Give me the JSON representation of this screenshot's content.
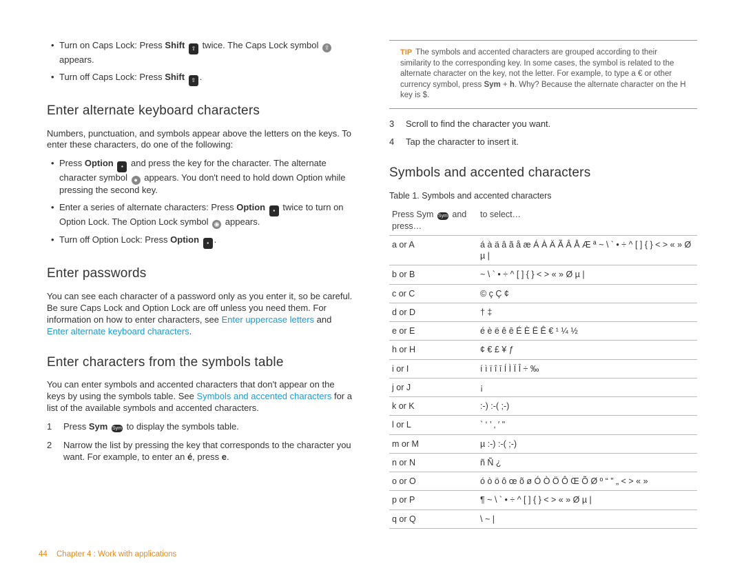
{
  "left": {
    "caps_on_a": "Turn on Caps Lock: Press ",
    "caps_on_b": " twice. The Caps Lock symbol ",
    "caps_on_c": " appears.",
    "caps_off_a": "Turn off Caps Lock: Press ",
    "h1": "Enter alternate keyboard characters",
    "p1": "Numbers, punctuation, and symbols appear above the letters on the keys. To enter these characters, do one of the following:",
    "alt1a": "Press ",
    "alt1b": " and press the key for the character. The alternate character symbol ",
    "alt1c": " appears. You don't need to hold down Option while pressing the second key.",
    "alt2a": "Enter a series of alternate characters: Press ",
    "alt2b": " twice to turn on Option Lock. The Option Lock symbol ",
    "alt2c": " appears.",
    "alt3a": "Turn off Option Lock: Press ",
    "h2": "Enter passwords",
    "p2a": "You can see each character of a password only as you enter it, so be careful. Be sure Caps Lock and Option Lock are off unless you need them. For information on how to enter characters, see ",
    "p2link1": "Enter uppercase letters",
    "p2mid": " and ",
    "p2link2": "Enter alternate keyboard characters",
    "h3": "Enter characters from the symbols table",
    "p3a": "You can enter symbols and accented characters that don't appear on the keys by using the symbols table. See ",
    "p3link": "Symbols and accented characters",
    "p3b": " for a list of the available symbols and accented characters.",
    "step1a": "Press ",
    "step1b": " to display the symbols table.",
    "step2a": "Narrow the list by pressing the key that corresponds to the character you want. For example, to enter an ",
    "step2b": ", press ",
    "word_shift": "Shift",
    "word_option": "Option",
    "word_sym": "Sym",
    "e_bold": "é",
    "e_plain": "e"
  },
  "right": {
    "tip_label": "TIP",
    "tip_a": "The symbols and accented characters are grouped according to their similarity to the corresponding key. In some cases, the symbol is related to the alternate character on the key, not the letter. For example, to type a € or other currency symbol, press ",
    "tip_b": ". Why? Because the alternate character on the H key is $.",
    "tip_sym": "Sym",
    "tip_h": "h",
    "step3": "Scroll to find the character you want.",
    "step4": "Tap the character to insert it.",
    "h4": "Symbols and accented characters",
    "table_caption": "Table 1.  Symbols and accented characters",
    "col1": "Press Sym ",
    "col1b": " and press…",
    "col2": "to select…",
    "rows": [
      {
        "k": "a or A",
        "v": "á à ä â ã å æ Á À Ä Ã Â Å Æ ª ~ \\ ` • ÷ ^ [ ] { } < > « » Ø µ |"
      },
      {
        "k": "b or B",
        "v": "~ \\ ` • ÷ ^ [ ] { } < > « » Ø µ |"
      },
      {
        "k": "c or C",
        "v": "© ç Ç ¢"
      },
      {
        "k": "d or D",
        "v": "† ‡"
      },
      {
        "k": "e or E",
        "v": "é è ë ê ē É È Ë Ê € ¹ ¼ ½"
      },
      {
        "k": "h or H",
        "v": "¢ € £ ¥ ƒ"
      },
      {
        "k": "i or I",
        "v": "í ì ï î ī Í Ì Ï Î ÷ ‰"
      },
      {
        "k": "j or J",
        "v": "¡"
      },
      {
        "k": "k or K",
        "v": ":-) :-( ;-)"
      },
      {
        "k": "l or L",
        "v": "` ‘ ’ ‚ ′ \""
      },
      {
        "k": "m or M",
        "v": "µ :-) :-( ;-)"
      },
      {
        "k": "n or N",
        "v": "ñ Ñ ¿"
      },
      {
        "k": "o or O",
        "v": "ó ò ö ô œ õ ø Ó Ò Ö Ô Œ Õ Ø º “ ” „ < > « »"
      },
      {
        "k": "p or P",
        "v": "¶ ~ \\ ` • ÷ ^ [ ] { } < > « » Ø µ |"
      },
      {
        "k": "q or Q",
        "v": "\\ ~ |"
      }
    ]
  },
  "footer": {
    "page": "44",
    "chapter": "Chapter 4 : Work with applications"
  }
}
